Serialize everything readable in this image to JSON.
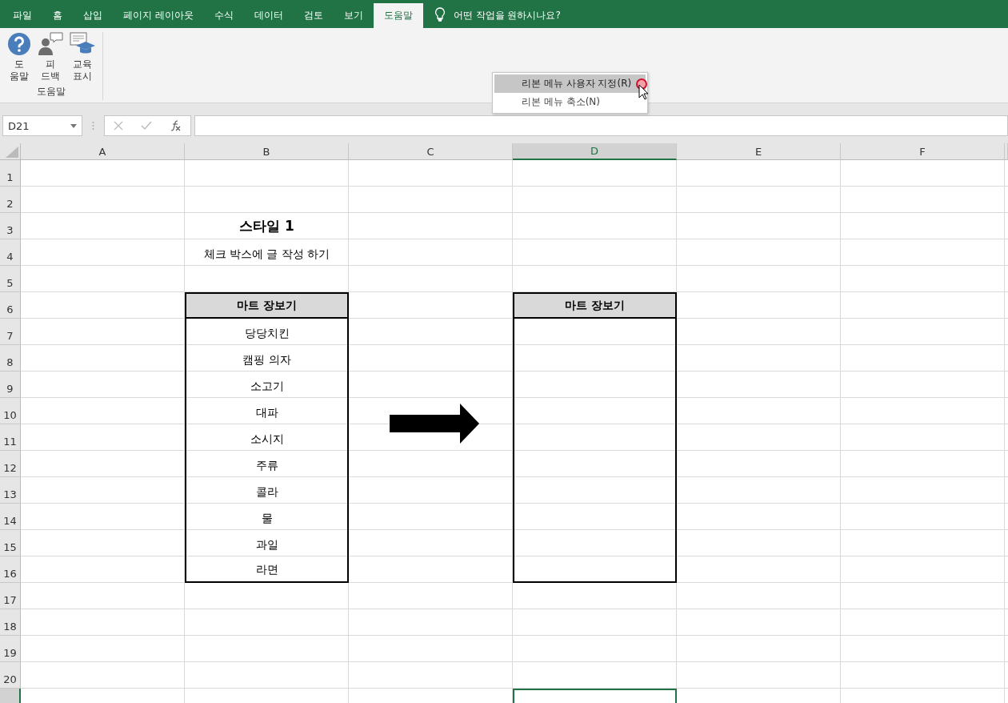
{
  "tabs": [
    {
      "label": "파일",
      "selected": false
    },
    {
      "label": "홈",
      "selected": false
    },
    {
      "label": "삽입",
      "selected": false
    },
    {
      "label": "페이지 레이아웃",
      "selected": false
    },
    {
      "label": "수식",
      "selected": false
    },
    {
      "label": "데이터",
      "selected": false
    },
    {
      "label": "검토",
      "selected": false
    },
    {
      "label": "보기",
      "selected": false
    },
    {
      "label": "도움말",
      "selected": true
    }
  ],
  "tell_me": {
    "placeholder": "어떤 작업을 원하시나요?"
  },
  "ribbon": {
    "groups": [
      {
        "label": "도움말",
        "buttons": [
          {
            "kind": "help",
            "lines": [
              "도",
              "움말"
            ]
          },
          {
            "kind": "feedback",
            "lines": [
              "피",
              "드백"
            ]
          },
          {
            "kind": "training",
            "lines": [
              "교육",
              "표시"
            ]
          }
        ]
      }
    ]
  },
  "context_menu": {
    "items": [
      {
        "label": "리본 메뉴 사용자 지정(R)",
        "selected": true
      },
      {
        "label": "리본 메뉴 축소(N)",
        "selected": false
      }
    ]
  },
  "formula_bar": {
    "name_box": "D21"
  },
  "columns": [
    {
      "label": "A",
      "selected": false
    },
    {
      "label": "B",
      "selected": false
    },
    {
      "label": "C",
      "selected": false
    },
    {
      "label": "D",
      "selected": true
    },
    {
      "label": "E",
      "selected": false
    },
    {
      "label": "F",
      "selected": false
    }
  ],
  "rows": [
    {
      "header": "1",
      "selected": false,
      "cells": {}
    },
    {
      "header": "2",
      "selected": false,
      "cells": {}
    },
    {
      "header": "3",
      "selected": false,
      "cells": {
        "B": {
          "kind": "title",
          "text": "스타일 1"
        }
      }
    },
    {
      "header": "4",
      "selected": false,
      "cells": {
        "B": {
          "kind": "text",
          "text": "체크 박스에 글 작성 하기"
        }
      }
    },
    {
      "header": "5",
      "selected": false,
      "cells": {}
    },
    {
      "header": "6",
      "selected": false,
      "cells": {
        "B": {
          "kind": "table_header",
          "text": "마트 장보기"
        },
        "D": {
          "kind": "table_header",
          "text": "마트 장보기"
        }
      }
    },
    {
      "header": "7",
      "selected": false,
      "cells": {
        "B": {
          "kind": "table_item",
          "text": "당당치킨"
        },
        "D": {
          "kind": "table_item"
        }
      }
    },
    {
      "header": "8",
      "selected": false,
      "cells": {
        "B": {
          "kind": "table_item",
          "text": "캠핑 의자"
        },
        "D": {
          "kind": "table_item"
        }
      }
    },
    {
      "header": "9",
      "selected": false,
      "cells": {
        "B": {
          "kind": "table_item",
          "text": "소고기"
        },
        "D": {
          "kind": "table_item"
        }
      }
    },
    {
      "header": "10",
      "selected": false,
      "cells": {
        "B": {
          "kind": "table_item",
          "text": "대파"
        },
        "D": {
          "kind": "table_item"
        }
      }
    },
    {
      "header": "11",
      "selected": false,
      "cells": {
        "B": {
          "kind": "table_item",
          "text": "소시지"
        },
        "D": {
          "kind": "table_item"
        }
      }
    },
    {
      "header": "12",
      "selected": false,
      "cells": {
        "B": {
          "kind": "table_item",
          "text": "주류"
        },
        "D": {
          "kind": "table_item"
        }
      }
    },
    {
      "header": "13",
      "selected": false,
      "cells": {
        "B": {
          "kind": "table_item",
          "text": "콜라"
        },
        "D": {
          "kind": "table_item"
        }
      }
    },
    {
      "header": "14",
      "selected": false,
      "cells": {
        "B": {
          "kind": "table_item",
          "text": "물"
        },
        "D": {
          "kind": "table_item"
        }
      }
    },
    {
      "header": "15",
      "selected": false,
      "cells": {
        "B": {
          "kind": "table_item",
          "text": "과일"
        },
        "D": {
          "kind": "table_item"
        }
      }
    },
    {
      "header": "16",
      "selected": false,
      "cells": {
        "B": {
          "kind": "table_end",
          "text": "라면"
        },
        "D": {
          "kind": "table_end"
        }
      }
    },
    {
      "header": "17",
      "selected": false,
      "cells": {}
    },
    {
      "header": "18",
      "selected": false,
      "cells": {}
    },
    {
      "header": "19",
      "selected": false,
      "cells": {}
    },
    {
      "header": "20",
      "selected": false,
      "cells": {}
    },
    {
      "selected": true,
      "cells": {
        "D": {
          "kind": "active"
        }
      }
    }
  ]
}
